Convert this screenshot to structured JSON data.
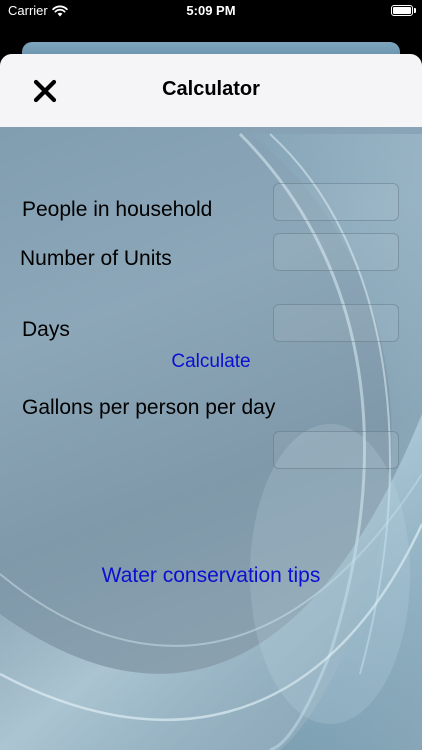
{
  "status_bar": {
    "carrier": "Carrier",
    "time": "5:09 PM",
    "wifi_icon": "wifi-icon",
    "battery_icon": "battery-icon"
  },
  "nav": {
    "title": "Calculator",
    "close_icon": "close-icon"
  },
  "form": {
    "people_label": "People in household",
    "people_value": "",
    "units_label": "Number of Units",
    "units_value": "",
    "days_label": "Days",
    "days_value": "",
    "calculate_label": "Calculate",
    "gallons_label": "Gallons per person per day",
    "gallons_value": ""
  },
  "tips_link": "Water conservation tips",
  "colors": {
    "link": "#0b0fd1",
    "nav_bg": "#f5f5f7"
  }
}
